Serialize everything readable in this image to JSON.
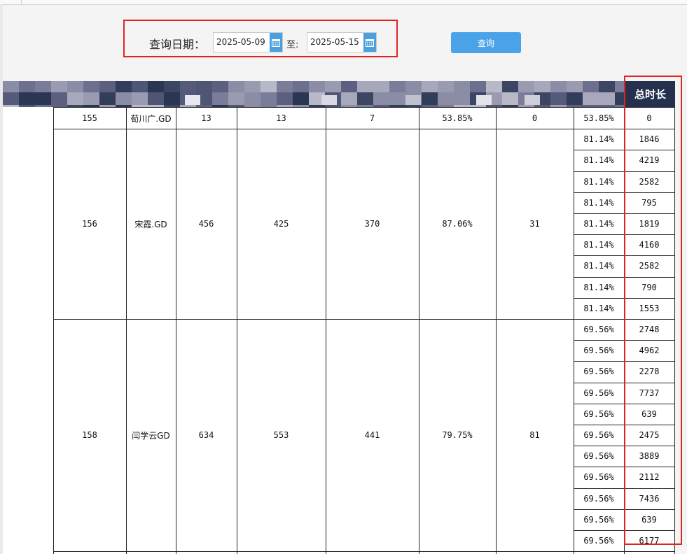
{
  "query": {
    "label": "查询日期：",
    "start_date": "2025-05-09",
    "to_label": "至:",
    "end_date": "2025-05-15",
    "button_label": "查询",
    "calendar_icon": "calendar-icon"
  },
  "table": {
    "total_duration_header": "总时长",
    "groups": [
      {
        "id": "155",
        "name": "荀川广.GD",
        "c1": "13",
        "c2": "13",
        "c3": "7",
        "rate": "53.85%",
        "c4": "0",
        "rows": [
          {
            "pct": "53.85%",
            "total": "0"
          }
        ]
      },
      {
        "id": "156",
        "name": "宋霞.GD",
        "c1": "456",
        "c2": "425",
        "c3": "370",
        "rate": "87.06%",
        "c4": "31",
        "rows": [
          {
            "pct": "81.14%",
            "total": "1846"
          },
          {
            "pct": "81.14%",
            "total": "4219"
          },
          {
            "pct": "81.14%",
            "total": "2582"
          },
          {
            "pct": "81.14%",
            "total": "795"
          },
          {
            "pct": "81.14%",
            "total": "1819"
          },
          {
            "pct": "81.14%",
            "total": "4160"
          },
          {
            "pct": "81.14%",
            "total": "2582"
          },
          {
            "pct": "81.14%",
            "total": "790"
          },
          {
            "pct": "81.14%",
            "total": "1553"
          }
        ]
      },
      {
        "id": "158",
        "name": "闫学云GD",
        "c1": "634",
        "c2": "553",
        "c3": "441",
        "rate": "79.75%",
        "c4": "81",
        "rows": [
          {
            "pct": "69.56%",
            "total": "2748"
          },
          {
            "pct": "69.56%",
            "total": "4962"
          },
          {
            "pct": "69.56%",
            "total": "2278"
          },
          {
            "pct": "69.56%",
            "total": "7737"
          },
          {
            "pct": "69.56%",
            "total": "639"
          },
          {
            "pct": "69.56%",
            "total": "2475"
          },
          {
            "pct": "69.56%",
            "total": "3889"
          },
          {
            "pct": "69.56%",
            "total": "2112"
          },
          {
            "pct": "69.56%",
            "total": "7436"
          },
          {
            "pct": "69.56%",
            "total": "639"
          },
          {
            "pct": "69.56%",
            "total": "6177"
          }
        ]
      }
    ]
  }
}
